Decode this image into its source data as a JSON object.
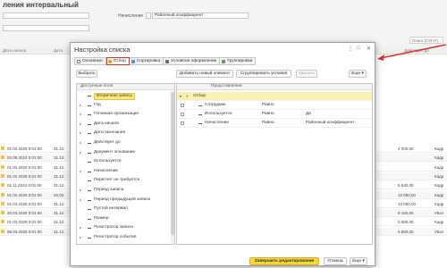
{
  "background": {
    "title": "ления интервальный",
    "filter_label": "Начисление",
    "filter_value": "Районный коэффициент",
    "search_placeholder": "Поиск (Ctrl+F)",
    "columns": {
      "date_start": "Дата начала",
      "date": "Дата",
      "active": "Действует до"
    },
    "rows": [
      {
        "date_start": "01.02.2025 0:01:00",
        "date": "31.12.",
        "amount": "4 000,00",
        "tail": "Кадр"
      },
      {
        "date_start": "02.09.2024 0:01:00",
        "date": "31.12.",
        "amount": "",
        "tail": "Кадр"
      },
      {
        "date_start": "01.02.2025 0:01:00",
        "date": "31.12.",
        "amount": "",
        "tail": "Кадр"
      },
      {
        "date_start": "01.02.2025 0:01:00",
        "date": "31.12.",
        "amount": "",
        "tail": "Кадр"
      },
      {
        "date_start": "01.11.2024 0:01:00",
        "date": "31.12.",
        "amount": "5 630,00",
        "tail": "Кадр"
      },
      {
        "date_start": "01.02.2025 0:01:00",
        "date": "28.02.",
        "amount": "10 080,00",
        "tail": "Кадр"
      },
      {
        "date_start": "01.03.2025 0:01:00",
        "date": "31.12.",
        "amount": "10 000,00",
        "tail": "Кадр"
      },
      {
        "date_start": "20.03.2025 0:01:00",
        "date": "31.12.",
        "amount": "8 180,00",
        "tail": "Увол"
      },
      {
        "date_start": "01.03.2025 0:01:00",
        "date": "31.12.",
        "amount": "5 680,00",
        "tail": "Кадр"
      },
      {
        "date_start": "06.03.2025 0:01:00",
        "date": "31.12.",
        "amount": "5 680,00",
        "tail": "Увол"
      }
    ]
  },
  "dialog": {
    "title": "Настройка списка",
    "tabs": [
      "Основные",
      "Отбор",
      "Сортировка",
      "Условное оформление",
      "Группировка"
    ],
    "toolbar": {
      "select": "Выбрать",
      "add_new": "Добавить новый элемент",
      "group_conditions": "Сгруппировать условия",
      "delete": "Удалить",
      "more": "Еще"
    },
    "fields_header": "Доступные поля",
    "fields": [
      "Вторичная запись",
      "Год",
      "Головная организация",
      "Дата начала",
      "Дата окончания",
      "Действует до",
      "Документ основание",
      "Используется",
      "Начисление",
      "Пересчет не требуется",
      "Период записи",
      "Период предыдущей записи",
      "Пустой интервал",
      "Размер",
      "Регистратор записи",
      "Регистратор события"
    ],
    "filter": {
      "header": "Представление",
      "group": "Отбор",
      "rows": [
        {
          "field": "Сотрудник",
          "condition": "Равно",
          "value": ""
        },
        {
          "field": "Используется",
          "condition": "Равно",
          "value": "Да"
        },
        {
          "field": "Начисление",
          "condition": "Равно",
          "value": "Районный коэффициент"
        }
      ]
    },
    "footer": {
      "finish": "Завершить редактирование",
      "cancel": "Отмена",
      "more": "Еще"
    }
  },
  "icons": {
    "dialog_more": "kebab-icon",
    "dialog_maximize": "maximize-icon",
    "dialog_close": "close-icon",
    "arrow": "red-arrow-annotation"
  }
}
